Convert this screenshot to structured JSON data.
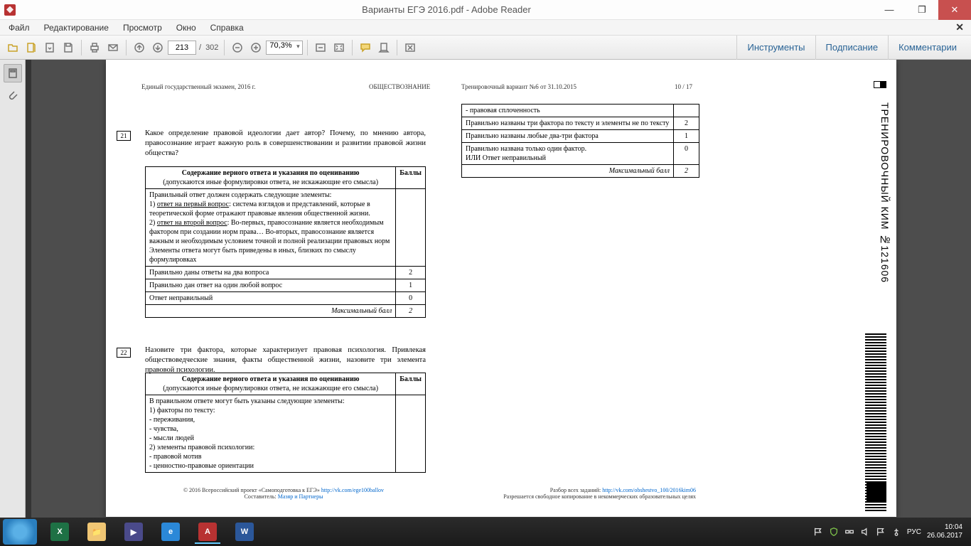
{
  "titlebar": {
    "title": "Варианты ЕГЭ 2016.pdf - Adobe Reader"
  },
  "menu": {
    "file": "Файл",
    "edit": "Редактирование",
    "view": "Просмотр",
    "window": "Окно",
    "help": "Справка"
  },
  "toolbar": {
    "page_current": "213",
    "page_sep": "/",
    "page_total": "302",
    "zoom": "70,3%"
  },
  "panels": {
    "tools": "Инструменты",
    "sign": "Подписание",
    "comments": "Комментарии"
  },
  "doc": {
    "hdr_left": "Единый государственный экзамен, 2016 г.",
    "hdr_center": "ОБЩЕСТВОЗНАНИЕ",
    "hdr_right": "Тренировочный вариант №6 от 31.10.2015",
    "hdr_pageno": "10 / 17",
    "side": "ТРЕНИРОВОЧНЫЙ КИМ №121606",
    "q21_num": "21",
    "q21_text": "Какое определение правовой идеологии дает автор? Почему, по мнению автора, правосознание играет важную роль в совершенствовании и развитии правовой жизни общества?",
    "t21_h1": "Содержание верного ответа и указания по оцениванию",
    "t21_h1b": "(допускаются иные формулировки ответа, не искажающие его смысла)",
    "t21_h2": "Баллы",
    "t21_r1": "Правильный ответ должен содержать следующие элементы:\n1) ответ на первый вопрос: система взглядов и представлений, которые в теоретической форме отражают правовые явления общественной жизни.\n2) ответ на второй вопрос: Во-первых, правосознание является необходимым фактором при создании норм права… Во-вторых, правосознание является важным и необходимым условием точной и полной реализации правовых норм\nЭлементы ответа могут быть приведены в иных, близких по смыслу формулировках",
    "t21_r2": "Правильно даны ответы на два вопроса",
    "t21_r2b": "2",
    "t21_r3": "Правильно дан ответ на один любой вопрос",
    "t21_r3b": "1",
    "t21_r4": "Ответ неправильный",
    "t21_r4b": "0",
    "t21_max": "Максимальный балл",
    "t21_maxb": "2",
    "q22_num": "22",
    "q22_text": "Назовите три фактора, которые характеризует правовая психология. Привлекая обществоведческие знания, факты общественной жизни, назовите три элемента правовой психологии.",
    "t22_h1": "Содержание верного ответа и указания по оцениванию",
    "t22_h1b": "(допускаются иные формулировки ответа, не искажающие его смысла)",
    "t22_h2": "Баллы",
    "t22_r1": "В правильном ответе могут быть указаны следующие элементы:\n1) факторы по тексту:\n- переживания,\n- чувства,\n- мысли людей\n2) элементы правовой психологии:\n- правовой мотив\n- ценностно-правовые ориентации",
    "tr_r1": "- правовая сплоченность",
    "tr_r2": "Правильно названы три фактора по тексту и элементы не по тексту",
    "tr_r2b": "2",
    "tr_r3": "Правильно названы любые два-три фактора",
    "tr_r3b": "1",
    "tr_r4": "Правильно названа только один фактор.\nИЛИ Ответ неправильный",
    "tr_r4b": "0",
    "tr_max": "Максимальный балл",
    "tr_maxb": "2",
    "footer_l1": "© 2016 Всероссийский проект «Самоподготовка к ЕГЭ» ",
    "footer_l1_link": "http://vk.com/ege100ballov",
    "footer_l2": "Составитель: ",
    "footer_l2_link": "Мазяр и Партнеры",
    "footer_r1": "Разбор всех заданий: ",
    "footer_r1_link": "http://vk.com/obshestvo_100/2016kim06",
    "footer_r2": "Разрешается свободное копирование в некоммерческих образовательных целях"
  },
  "tray": {
    "lang": "РУС",
    "time": "10:04",
    "date": "26.06.2017"
  }
}
